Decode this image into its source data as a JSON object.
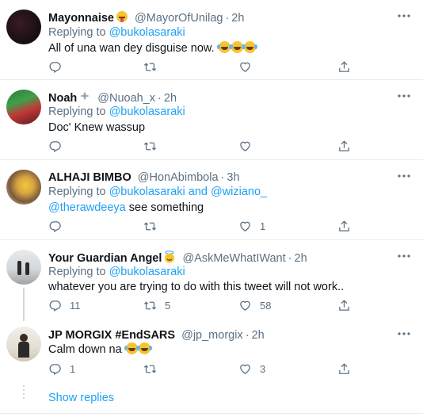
{
  "tweets": [
    {
      "name": "Mayonnaise",
      "handle": "@MayorOfUnilag",
      "time": "2h",
      "replying_prefix": "Replying to",
      "replying_to": "@bukolasaraki",
      "replying_extra": "",
      "text": "All of una wan dey disguise now.",
      "text2": "",
      "counts": {
        "reply": "",
        "retweet": "",
        "like": ""
      }
    },
    {
      "name": "Noah",
      "handle": "@Nuoah_x",
      "time": "2h",
      "replying_prefix": "Replying to",
      "replying_to": "@bukolasaraki",
      "replying_extra": "",
      "text": "Doc' Knew wassup",
      "text2": "",
      "counts": {
        "reply": "",
        "retweet": "",
        "like": ""
      }
    },
    {
      "name": "ALHAJI BIMBO",
      "handle": "@HonAbimbola",
      "time": "3h",
      "replying_prefix": "Replying to",
      "replying_to": "@bukolasaraki",
      "replying_and": "and",
      "replying_extra": "@wiziano_",
      "text_mention": "@therawdeeya",
      "text": "see something",
      "counts": {
        "reply": "",
        "retweet": "",
        "like": "1"
      }
    },
    {
      "name": "Your Guardian Angel",
      "handle": "@AskMeWhatIWant",
      "time": "2h",
      "replying_prefix": "Replying to",
      "replying_to": "@bukolasaraki",
      "text": "whatever you are trying to do with this tweet will not  work..",
      "counts": {
        "reply": "11",
        "retweet": "5",
        "like": "58"
      }
    },
    {
      "name": "JP MORGIX #EndSARS",
      "handle": "@jp_morgix",
      "time": "2h",
      "text": "Calm down na",
      "counts": {
        "reply": "1",
        "retweet": "",
        "like": "3"
      }
    }
  ],
  "separator": "·",
  "show_replies": "Show replies",
  "colors": {
    "link": "#1da1f2",
    "muted": "#5b7083",
    "border": "#e6ecf0"
  },
  "icons": [
    "reply-icon",
    "retweet-icon",
    "like-icon",
    "share-icon",
    "more-icon"
  ]
}
